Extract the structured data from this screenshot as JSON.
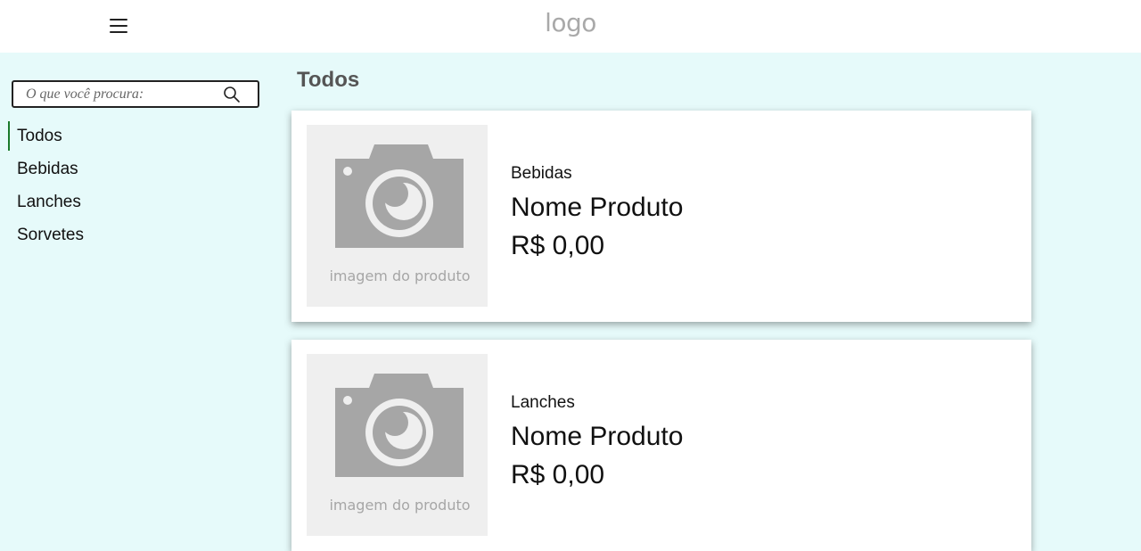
{
  "header": {
    "menu_icon": "hamburger-menu-icon",
    "logo_text": "logo"
  },
  "search": {
    "placeholder": "O que você procura:",
    "value": "",
    "icon": "search-icon"
  },
  "sidebar": {
    "items": [
      {
        "label": "Todos",
        "active": true
      },
      {
        "label": "Bebidas",
        "active": false
      },
      {
        "label": "Lanches",
        "active": false
      },
      {
        "label": "Sorvetes",
        "active": false
      }
    ],
    "active_color": "#1b7a2b"
  },
  "main": {
    "title": "Todos",
    "products": [
      {
        "image_caption": "imagem do produto",
        "image_icon": "camera-icon",
        "category": "Bebidas",
        "name": "Nome Produto",
        "price": "R$ 0,00"
      },
      {
        "image_caption": "imagem do produto",
        "image_icon": "camera-icon",
        "category": "Lanches",
        "name": "Nome Produto",
        "price": "R$ 0,00"
      }
    ]
  },
  "colors": {
    "background": "#e6fafa",
    "header": "#ffffff",
    "card": "#ffffff",
    "placeholder_gray": "#a6a6a6"
  }
}
